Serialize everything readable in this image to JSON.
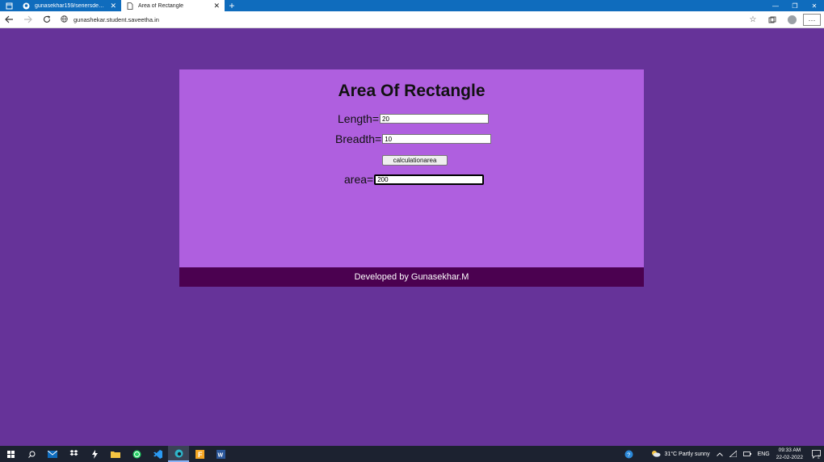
{
  "browser": {
    "tabs": [
      {
        "label": "gunasekhar159/seriersdeproces",
        "icon": "github-icon",
        "close": "✕"
      },
      {
        "label": "Area of Rectangle",
        "icon": "page-icon",
        "close": "✕"
      }
    ],
    "new_tab": "+",
    "url": "gunashekar.student.saveetha.in",
    "window_controls": {
      "minimize": "—",
      "restore": "❐",
      "close": "✕"
    },
    "more_label": "···"
  },
  "page": {
    "title": "Area Of Rectangle",
    "length_label": "Length=",
    "length_value": "20",
    "breadth_label": "Breadth=",
    "breadth_value": "10",
    "button_label": "calculationarea",
    "area_label": "area=",
    "area_value": "200",
    "footer": "Developed by Gunasekhar.M"
  },
  "taskbar": {
    "weather": "31°C  Partly sunny",
    "language": "ENG",
    "time": "09:33 AM",
    "date": "22-02-2022",
    "notifications": "2"
  },
  "colors": {
    "page_bg": "#663399",
    "card_bg": "#af5fdf",
    "footer_bg": "#4b0150",
    "tab_bar": "#0f6cbd"
  }
}
